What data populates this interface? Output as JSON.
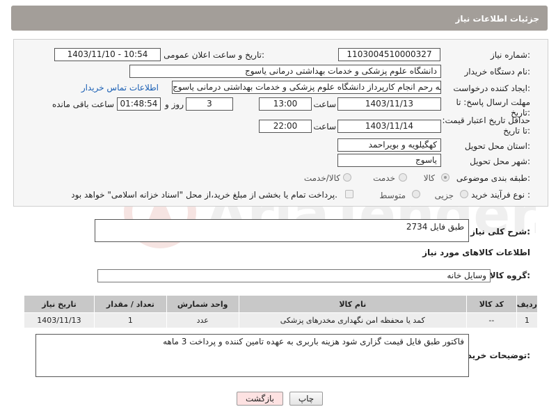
{
  "header": {
    "title": "جزئیات اطلاعات نیاز"
  },
  "form": {
    "need_number_label": "شماره نیاز:",
    "need_number": "1103004510000327",
    "announce_label": "تاریخ و ساعت اعلان عمومی:",
    "announce_value": "1403/11/10 - 10:54",
    "buyer_org_label": "نام دستگاه خریدار:",
    "buyer_org": "دانشگاه علوم پزشکی و خدمات بهداشتی  درمانی یاسوج",
    "requester_label": "ایجاد کننده درخواست:",
    "requester": "اله رحم انجام کارپرداز دانشگاه علوم پزشکی و خدمات بهداشتی  درمانی یاسوج",
    "contact_link": "اطلاعات تماس خریدار",
    "deadline_label": "مهلت ارسال پاسخ: تا تاریخ:",
    "deadline_date": "1403/11/13",
    "time_label": "ساعت",
    "deadline_time": "13:00",
    "days": "3",
    "days_label": "روز و",
    "remaining": "01:48:54",
    "remaining_label": "ساعت باقی مانده",
    "validity_label": "حداقل تاریخ اعتبار قیمت: تا تاریخ:",
    "validity_date": "1403/11/14",
    "validity_time": "22:00",
    "province_label": "استان محل تحویل:",
    "province": "کهگیلویه و بویراحمد",
    "city_label": "شهر محل تحویل:",
    "city": "یاسوج",
    "category_label": "طبقه بندی موضوعی:",
    "category_options": [
      "کالا",
      "خدمت",
      "کالا/خدمت"
    ],
    "process_label": "نوع فرآیند خرید :",
    "process_options": [
      "جزیی",
      "متوسط"
    ],
    "payment_note": "پرداخت تمام یا بخشی از مبلغ خرید،از محل \"اسناد خزانه اسلامی\" خواهد بود."
  },
  "summary": {
    "label": "شرح کلی نیاز:",
    "value": "طبق فایل 2734"
  },
  "goods": {
    "section_title": "اطلاعات کالاهای مورد نیاز",
    "group_label": "گروه کالا:",
    "group_value": "وسایل خانه",
    "columns": [
      "ردیف",
      "کد کالا",
      "نام کالا",
      "واحد شمارش",
      "تعداد / مقدار",
      "تاریخ نیاز"
    ],
    "rows": [
      {
        "row": "1",
        "code": "--",
        "name": "کمد یا محفظه امن نگهداری مخدرهای پزشکی",
        "unit": "عدد",
        "qty": "1",
        "date": "1403/11/13"
      }
    ]
  },
  "buyer_notes": {
    "label": "توضیحات خریدار:",
    "value": "فاکتور طبق فایل قیمت گزاری شود هزینه باربری به عهده تامین کننده و پرداخت 3 ماهه"
  },
  "buttons": {
    "print": "چاپ",
    "back": "بازگشت"
  },
  "colors": {
    "header": "#a39e99",
    "back_button": "#fde2e2",
    "link": "#1a5fb4"
  }
}
